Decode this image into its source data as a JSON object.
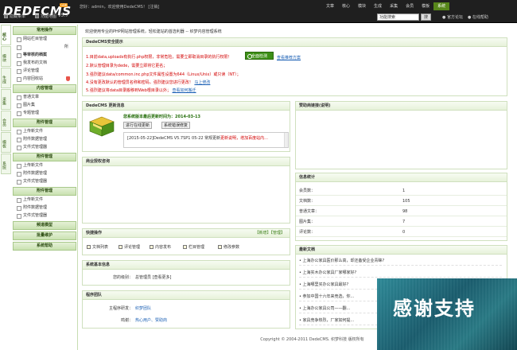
{
  "brand": {
    "logo": "DEDECMS",
    "version": "v5.7",
    "badge": "GBK"
  },
  "topbar": {
    "greeting": "您好：admin，欢迎使用DedeCMS！ [注销]"
  },
  "topnav": {
    "items": [
      "文章",
      "核心",
      "模块",
      "生成",
      "采集",
      "会员",
      "模板",
      "系统"
    ],
    "active_index": 7
  },
  "toolbar": {
    "hide_menu": "隐藏菜单",
    "feature_map": "功能地图",
    "search_placeholder": "功能搜索",
    "go": "搜",
    "official": "官方论坛",
    "help": "在线帮助"
  },
  "sidetabs": [
    "核心",
    "模块",
    "生成",
    "采集",
    "会员",
    "模板",
    "系统"
  ],
  "menu": {
    "groups": [
      {
        "title": "常用操作",
        "items": [
          {
            "label": "网站栏目管理"
          },
          {
            "label": "所",
            "tail": true
          },
          {
            "label": "等审核的档案",
            "bold": true
          },
          {
            "label": "我发布的文档"
          },
          {
            "label": "评论管理"
          },
          {
            "label": "内容回收站",
            "shield": true
          }
        ]
      },
      {
        "title": "内容管理",
        "items": [
          {
            "label": "普通文章"
          },
          {
            "label": "图片集"
          },
          {
            "label": "专题管理"
          }
        ]
      },
      {
        "title": "附件管理",
        "items": [
          {
            "label": "上传新文件"
          },
          {
            "label": "附件数据管理"
          },
          {
            "label": "文件式管理器"
          }
        ]
      },
      {
        "title": "附件管理",
        "items": [
          {
            "label": "上传新文件"
          },
          {
            "label": "附件数据管理"
          },
          {
            "label": "文件式管理器"
          }
        ]
      },
      {
        "title": "附件管理",
        "items": [
          {
            "label": "上传新文件"
          },
          {
            "label": "附件数据管理"
          },
          {
            "label": "文件式管理器"
          }
        ]
      },
      {
        "title": "频道模型",
        "items": []
      },
      {
        "title": "批量维护",
        "items": []
      },
      {
        "title": "系统帮助",
        "items": []
      }
    ]
  },
  "welcome": "欢迎使用专业的PHP网站管理系统，轻松建站的首选利器 -- 织梦内容管理系统",
  "safe": {
    "title": "DedeCMS安全提示",
    "lines": [
      "1.目前data,uploads有执行.php权限，非常危险，需要立即取消目录的执行权限！",
      "2.默认管理目录为dede，需要立即将它更名；",
      "3.强烈建议data/common.inc.php文件属性设置为644（Linux/Unix）或只读（NT）；",
      "4.没有更改默认的管理员名称和密码，强烈建议您进行更改！",
      "5.强烈建议将data目录搬移到Web根目录以外；"
    ],
    "modify_link": "马上修改",
    "howto_link": "查看如何搬迁",
    "check_button": "全面检测",
    "recommend_link": "查看推荐方案"
  },
  "update": {
    "title": "DedeCMS 更新消息",
    "current": "您系统版本最后更新时间为：2014-03-13",
    "btn_check": "进行在线更新",
    "btn_log": "系统错误修复",
    "log": "[2015-05-22]DedeCMS V5.7SP1 05-22 常规更新",
    "log_link": "更新说明",
    "log_extra": "，增加百度站内..."
  },
  "sponsor": {
    "title": "赞助商链接(说明)"
  },
  "auth": {
    "title": "商业授权咨询"
  },
  "info": {
    "title": "信息统计",
    "rows": [
      {
        "k": "会员数：",
        "v": "1"
      },
      {
        "k": "文档数：",
        "v": "105"
      },
      {
        "k": "普通文章：",
        "v": "98"
      },
      {
        "k": "图片集：",
        "v": "7"
      },
      {
        "k": "评论数：",
        "v": "0"
      }
    ]
  },
  "quick": {
    "title": "快捷操作",
    "actions": "【新增】【管理】",
    "links": [
      "文档列表",
      "评论管理",
      "内容发布",
      "栏目管理",
      "修改参数"
    ]
  },
  "sysinfo": {
    "title": "系统基本信息",
    "label": "您的级别：",
    "value": "总管理员 [查看更多]"
  },
  "team": {
    "title": "程序团队",
    "rows": [
      {
        "k": "主程序研发：",
        "v": "织梦团队"
      },
      {
        "k": "鸣谢：",
        "v": "热心用户、赞助商"
      }
    ]
  },
  "latest": {
    "title": "最新文档",
    "items": [
      "上海办公家具医价那么高，却还备受企业青睐?",
      "上海实木办公家具厂家哪家好?",
      "上海哪里买办公家具最好?",
      "参加中国十六年来竞选，你...",
      "上海办公家具公司——翻...",
      "家具竞争热烈，厂家如何提..."
    ]
  },
  "footer": "Copyright © 2004-2011 DedeCMS. 织梦科技 版权所有",
  "overlay": {
    "text": "感谢支持"
  }
}
